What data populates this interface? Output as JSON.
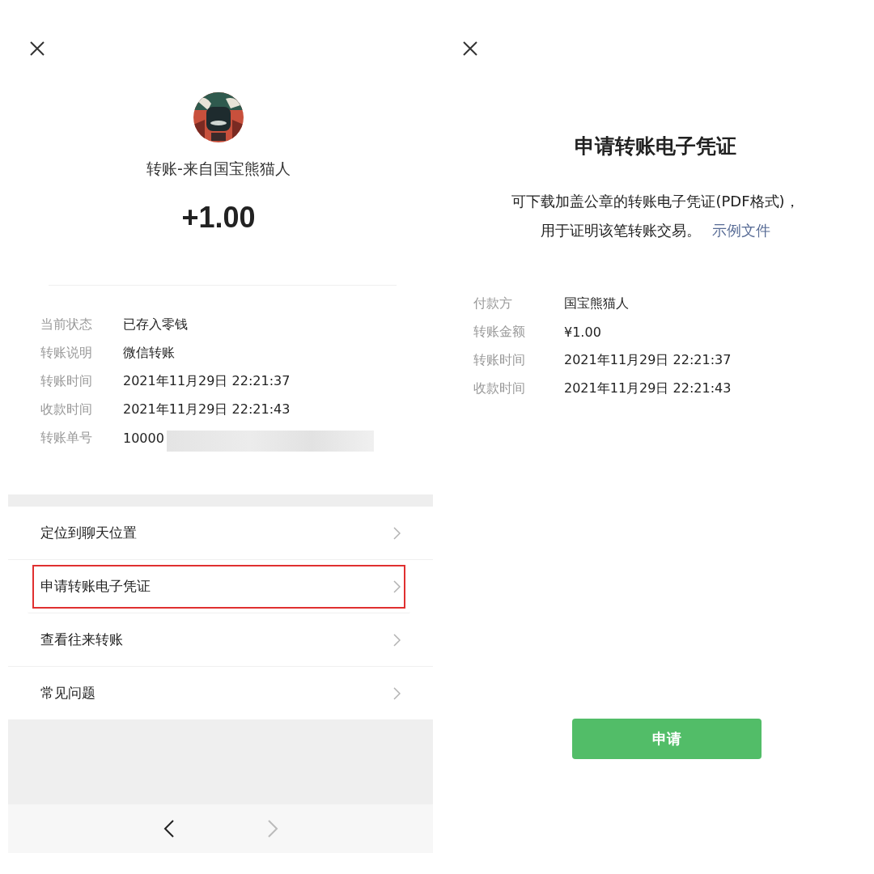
{
  "transfer_detail": {
    "title": "转账-来自国宝熊猫人",
    "amount": "+1.00",
    "details": [
      {
        "label": "当前状态",
        "value": "已存入零钱",
        "redacted": false
      },
      {
        "label": "转账说明",
        "value": "微信转账",
        "redacted": false
      },
      {
        "label": "转账时间",
        "value": "2021年11月29日 22:21:37",
        "redacted": false
      },
      {
        "label": "收款时间",
        "value": "2021年11月29日 22:21:43",
        "redacted": false
      },
      {
        "label": "转账单号",
        "value": "10000",
        "redacted": true
      }
    ],
    "menu": [
      {
        "label": "定位到聊天位置",
        "highlighted": false
      },
      {
        "label": "申请转账电子凭证",
        "highlighted": true
      },
      {
        "label": "查看往来转账",
        "highlighted": false
      },
      {
        "label": "常见问题",
        "highlighted": false
      }
    ],
    "nav": {
      "back_disabled": false,
      "forward_disabled": true
    }
  },
  "voucher": {
    "title": "申请转账电子凭证",
    "description": "可下载加盖公章的转账电子凭证(PDF格式)，",
    "description_2": "用于证明该笔转账交易。",
    "link": "示例文件",
    "details": [
      {
        "label": "付款方",
        "value": "国宝熊猫人"
      },
      {
        "label": "转账金额",
        "value": "¥1.00"
      },
      {
        "label": "转账时间",
        "value": "2021年11月29日 22:21:37"
      },
      {
        "label": "收款时间",
        "value": "2021年11月29日 22:21:43"
      }
    ],
    "button": "申请"
  }
}
